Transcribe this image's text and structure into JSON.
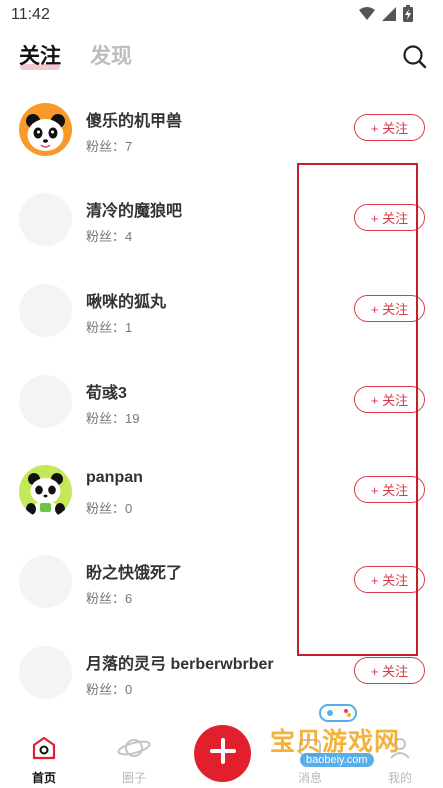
{
  "status_bar": {
    "time": "11:42",
    "icons": [
      "wifi-icon",
      "signal-icon",
      "battery-charging-icon"
    ]
  },
  "top_tabs": {
    "follow_label": "关注",
    "discover_label": "发现",
    "active": "关注"
  },
  "colors": {
    "accent": "#e2202d",
    "button_border": "#d83a47",
    "highlight": "#c4202b",
    "tab_underline": "#f7c8cf"
  },
  "users": [
    {
      "name": "傻乐的机甲兽",
      "fans": "粉丝：7",
      "avatar": "panda-orange"
    },
    {
      "name": "清冷的魔狼吧",
      "fans": "粉丝：4",
      "avatar": "blank"
    },
    {
      "name": "啾咪的狐丸",
      "fans": "粉丝：1",
      "avatar": "blank"
    },
    {
      "name": "荀彧3",
      "fans": "粉丝：19",
      "avatar": "blank"
    },
    {
      "name": "panpan",
      "fans": "粉丝：0",
      "avatar": "panda-green"
    },
    {
      "name": "盼之快饿死了",
      "fans": "粉丝：6",
      "avatar": "blank"
    },
    {
      "name": "月落的灵弓 berberwbrber",
      "fans": "粉丝：0",
      "avatar": "blank"
    }
  ],
  "follow_button_label": "+ 关注",
  "bottom_nav": {
    "home": "首页",
    "circle": "圈子",
    "message": "消息",
    "mine": "我的"
  },
  "watermark": {
    "text": "宝贝游戏网",
    "url": "baobeiy.com"
  }
}
